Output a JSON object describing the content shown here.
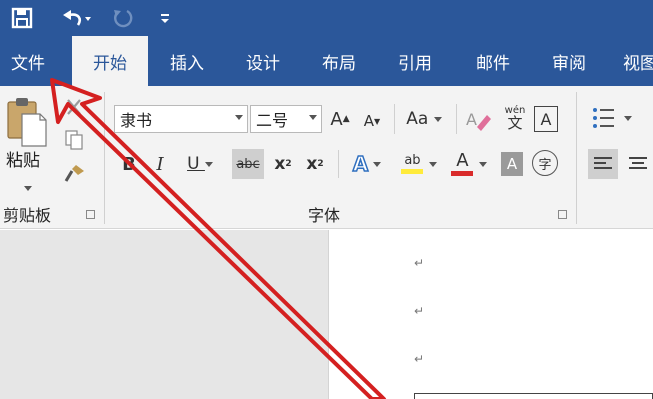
{
  "quick_access": {
    "save_icon": "save-icon",
    "undo_icon": "undo-icon",
    "redo_icon": "redo-icon",
    "customize_icon": "customize-qat-icon"
  },
  "tabs": [
    {
      "label": "文件"
    },
    {
      "label": "开始"
    },
    {
      "label": "插入"
    },
    {
      "label": "设计"
    },
    {
      "label": "布局"
    },
    {
      "label": "引用"
    },
    {
      "label": "邮件"
    },
    {
      "label": "审阅"
    },
    {
      "label": "视图"
    }
  ],
  "clipboard": {
    "paste_label": "粘贴",
    "group_label": "剪贴板"
  },
  "font": {
    "font_name": "隶书",
    "font_size": "二号",
    "grow_label": "A",
    "shrink_label": "A",
    "case_label": "Aa",
    "pinyin_top": "wén",
    "pinyin_bottom": "文",
    "border_label": "A",
    "bold_label": "B",
    "italic_label": "I",
    "underline_label": "U",
    "strike_label": "abc",
    "sub_label": "x",
    "sub_mark": "2",
    "sup_label": "x",
    "sup_mark": "2",
    "effects_label": "A",
    "highlight_label": "ab",
    "color_label": "A",
    "shade_label": "A",
    "enclose_label": "字",
    "group_label": "字体"
  },
  "document": {
    "paragraph_mark": "↵"
  },
  "colors": {
    "ribbon_blue": "#2b579a",
    "annotation_red": "#d42020",
    "highlight_yellow": "#ffeb3b",
    "font_red": "#d92b2b"
  }
}
